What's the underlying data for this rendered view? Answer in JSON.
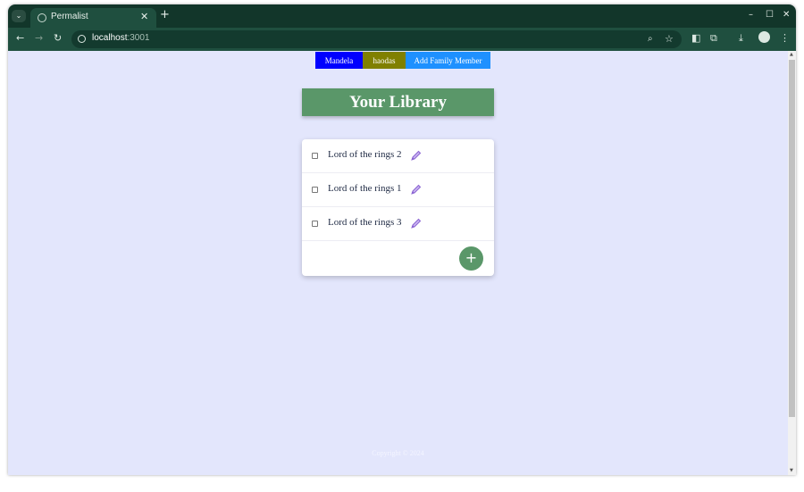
{
  "browser": {
    "tab_title": "Permalist",
    "tab_close": "✕",
    "new_tab": "+",
    "url_host": "localhost",
    "url_port": ":3001",
    "window_controls": {
      "minimize": "–",
      "maximize": "☐",
      "close": "✕"
    }
  },
  "family_nav": {
    "members": [
      "Mandela",
      "haodas"
    ],
    "add_label": "Add Family Member",
    "colors": {
      "mandela": "#0000ff",
      "haodas": "#808000",
      "add": "#1e90ff"
    }
  },
  "heading": {
    "title": "Your Library",
    "background": "#5a9769"
  },
  "items": [
    {
      "title": "Lord of the rings 2",
      "checked": false
    },
    {
      "title": "Lord of the rings 1",
      "checked": false
    },
    {
      "title": "Lord of the rings 3",
      "checked": false
    }
  ],
  "add_button": {
    "label": "+"
  },
  "footer": {
    "text": "Copyright © 2024"
  },
  "page_background": "#e3e6fc"
}
